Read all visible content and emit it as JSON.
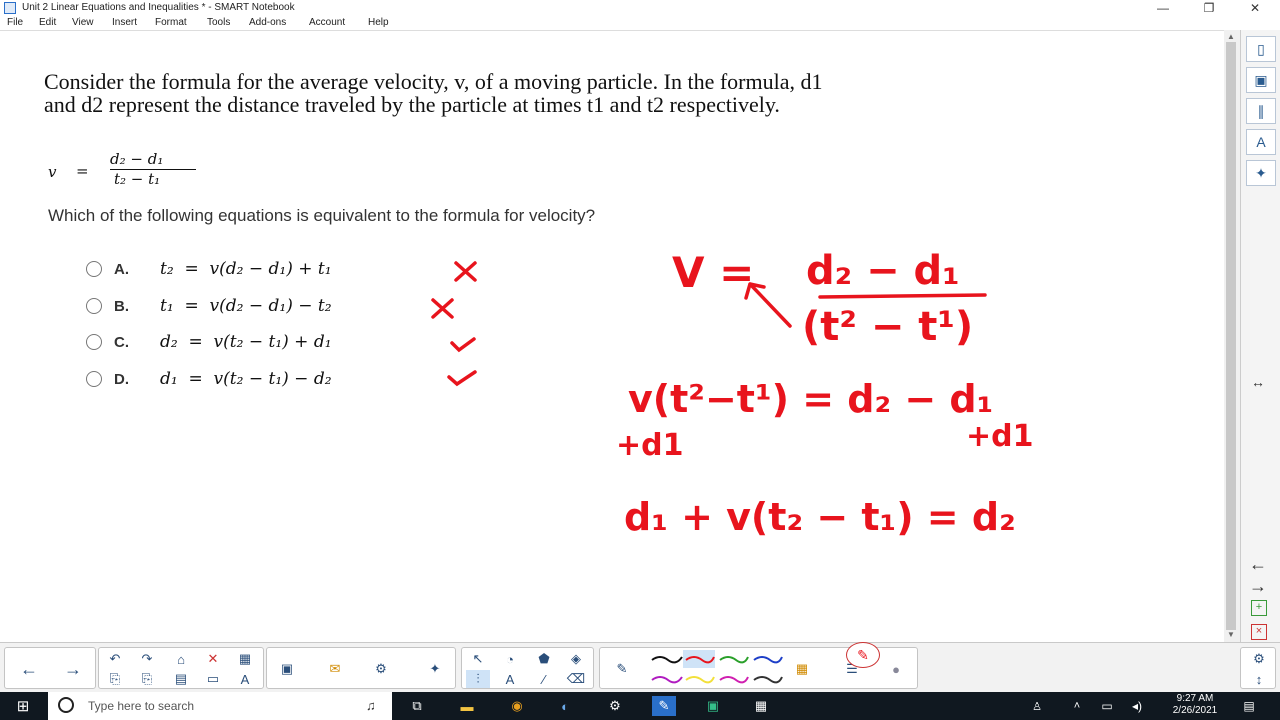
{
  "window": {
    "title": "Unit 2 Linear Equations and Inequalities * - SMART Notebook",
    "minimize": "—",
    "maximize": "❐",
    "close": "✕"
  },
  "menu": [
    "File",
    "Edit",
    "View",
    "Insert",
    "Format",
    "Tools",
    "Add-ons",
    "Account",
    "Help"
  ],
  "page": {
    "question_line1": "Consider the formula for the average velocity, v, of a moving particle. In the formula, d1",
    "question_line2": "and d2 represent the distance traveled by the particle at times t1 and t2 respectively.",
    "formula": {
      "lhs": "v",
      "eq": "=",
      "numerator": "d₂ − d₁",
      "denominator": "t₂ − t₁"
    },
    "prompt": "Which of the following equations is equivalent to the formula for velocity?",
    "options": [
      {
        "letter": "A.",
        "equation": "t₂  =  v(d₂ − d₁) + t₁"
      },
      {
        "letter": "B.",
        "equation": "t₁  =  v(d₂ − d₁) − t₂"
      },
      {
        "letter": "C.",
        "equation": "d₂  =  v(t₂ − t₁) + d₁"
      },
      {
        "letter": "D.",
        "equation": "d₁  =  v(t₂ − t₁) − d₂"
      }
    ]
  },
  "ink_color": "#e8141d",
  "handwriting": {
    "line1_lhs": "V =",
    "line1_num": "d₂ − d₁",
    "line1_den": "(t² − t¹)",
    "line2": "v(t²−t¹) = d₂ − d₁",
    "add_left": "+d1",
    "add_right": "+d1",
    "line3": "d₁ + v(t₂ − t₁) = d₂"
  },
  "sidetabs": [
    "page-sorter-icon",
    "gallery-icon",
    "attachments-icon",
    "properties-icon",
    "addons-icon"
  ],
  "taskbar": {
    "search_placeholder": "Type here to search",
    "time": "9:27 AM",
    "date": "2/26/2021"
  }
}
